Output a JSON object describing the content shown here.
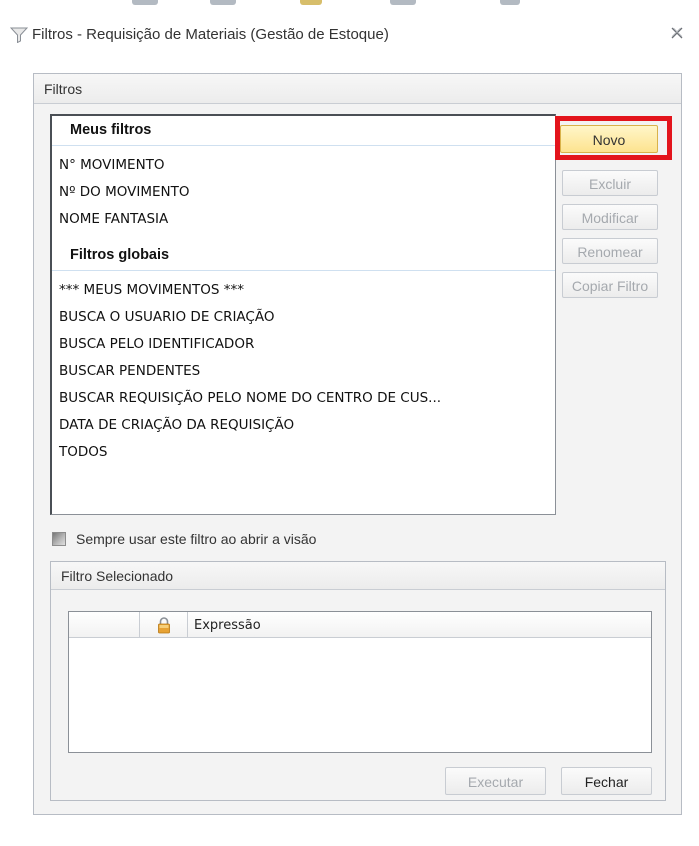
{
  "window": {
    "title": "Filtros - Requisição de Materiais (Gestão de Estoque)",
    "icons": {
      "title": "funnel-icon",
      "close": "close-icon"
    }
  },
  "filters_group": {
    "header": "Filtros",
    "my_filters": {
      "header": "Meus filtros",
      "items": [
        "N° MOVIMENTO",
        "Nº DO MOVIMENTO",
        "NOME FANTASIA"
      ]
    },
    "global_filters": {
      "header": "Filtros globais",
      "items": [
        "*** MEUS MOVIMENTOS ***",
        "BUSCA O USUARIO DE CRIAÇÃO",
        "BUSCA PELO IDENTIFICADOR",
        "BUSCAR PENDENTES",
        "BUSCAR REQUISIÇÃO PELO NOME DO CENTRO DE CUS...",
        "DATA DE CRIAÇÃO DA REQUISIÇÃO",
        "TODOS"
      ]
    },
    "buttons": {
      "novo": "Novo",
      "excluir": "Excluir",
      "modificar": "Modificar",
      "renomear": "Renomear",
      "copiar": "Copiar Filtro"
    },
    "highlight_color": "#e3141c",
    "always_use_label": "Sempre usar este filtro ao abrir a visão"
  },
  "selected_filter": {
    "header": "Filtro Selecionado",
    "columns": [
      "",
      "lock-icon",
      "Expressão"
    ],
    "rows": []
  },
  "footer": {
    "execute": "Executar",
    "close": "Fechar"
  }
}
